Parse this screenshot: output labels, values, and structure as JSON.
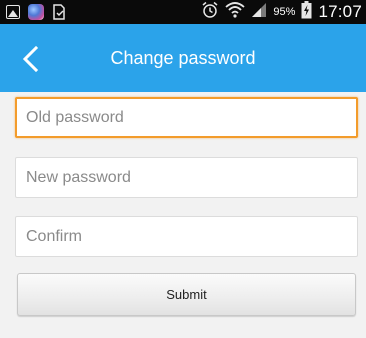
{
  "status_bar": {
    "left_icons": [
      "gallery-icon",
      "app-icon",
      "download-icon"
    ],
    "right_icons": [
      "alarm-icon",
      "wifi-icon",
      "signal-icon",
      "battery-charging-icon"
    ],
    "battery_percent": "95%",
    "time": "17:07"
  },
  "header": {
    "title": "Change password",
    "back_icon": "chevron-left-icon",
    "background_color": "#2ba3ea"
  },
  "form": {
    "old_password": {
      "placeholder": "Old password",
      "value": ""
    },
    "new_password": {
      "placeholder": "New password",
      "value": ""
    },
    "confirm": {
      "placeholder": "Confirm",
      "value": ""
    },
    "submit_label": "Submit",
    "focus_color": "#f39c2b"
  }
}
